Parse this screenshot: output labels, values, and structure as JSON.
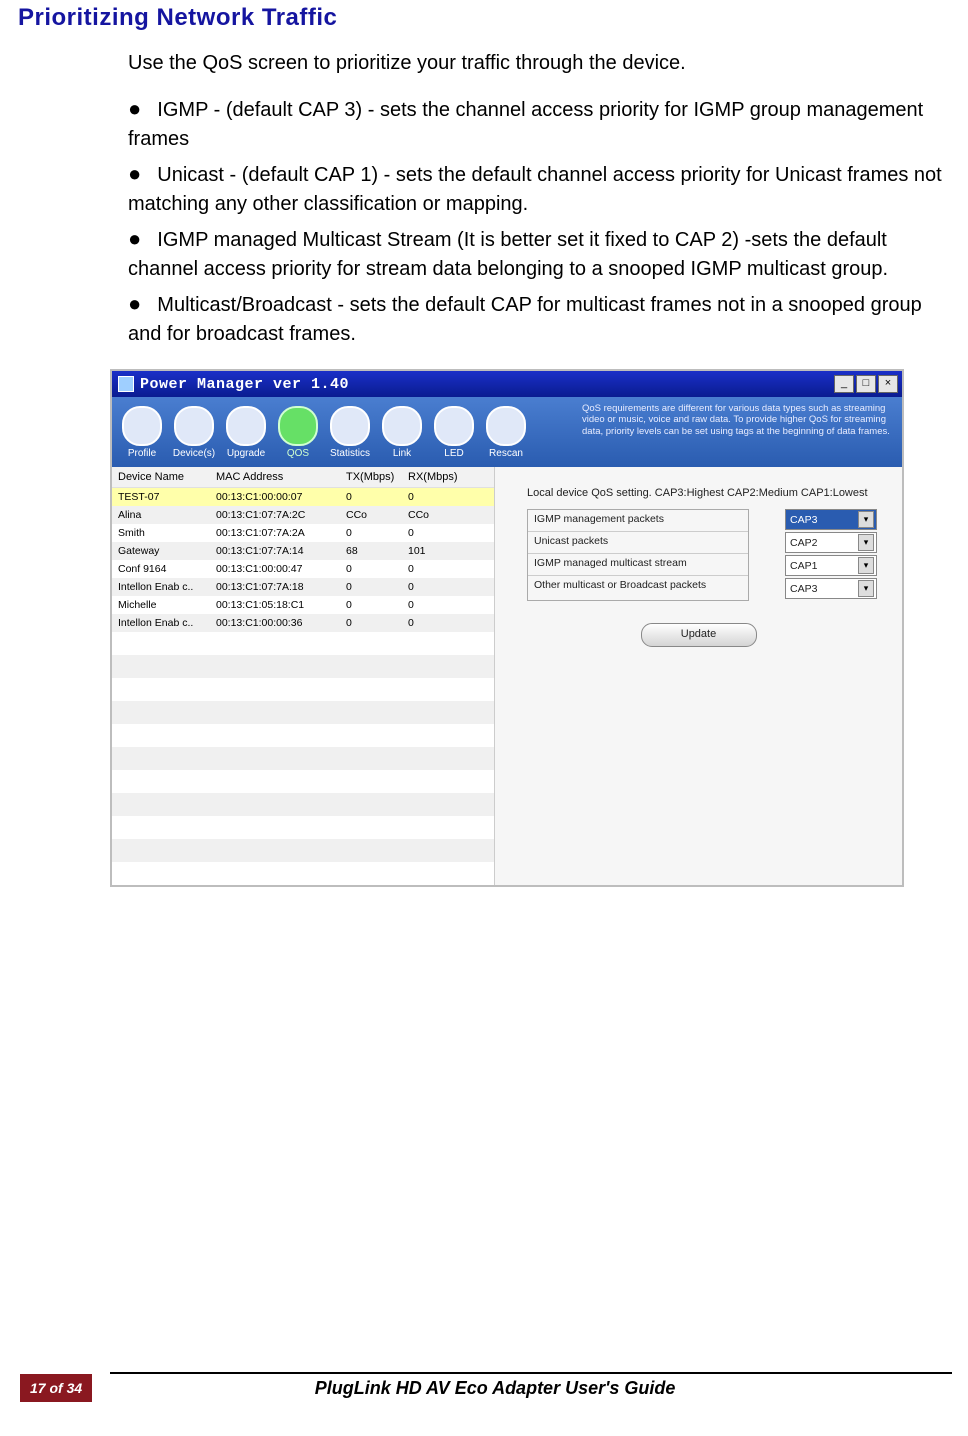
{
  "title": "Prioritizing Network Traffic",
  "intro": "Use the QoS screen to prioritize your traffic through the device.",
  "bullets": [
    "IGMP - (default CAP 3) - sets the channel access priority for IGMP group management frames",
    "Unicast - (default CAP 1) - sets the default channel access priority for Unicast frames not matching any other classification or mapping.",
    "IGMP managed Multicast Stream (It is better set it fixed to CAP 2) -sets the default channel access priority for stream data belonging to a snooped IGMP multicast group.",
    "Multicast/Broadcast - sets the default CAP for multicast frames not in a snooped group and for broadcast frames."
  ],
  "app": {
    "window_title": "Power Manager ver 1.40",
    "toolbar": [
      "Profile",
      "Device(s)",
      "Upgrade",
      "QOS",
      "Statistics",
      "Link",
      "LED",
      "Rescan"
    ],
    "active_tab": "QOS",
    "qos_desc": "QoS requirements are different for various data types such as streaming video or music, voice and raw data. To provide higher QoS for streaming data, priority levels can be set using tags at the beginning of data frames.",
    "table_headers": {
      "c1": "Device Name",
      "c2": "MAC Address",
      "c3": "TX(Mbps)",
      "c4": "RX(Mbps)"
    },
    "devices": [
      {
        "name": "TEST-07",
        "mac": "00:13:C1:00:00:07",
        "tx": "0",
        "rx": "0",
        "sel": true
      },
      {
        "name": "Alina",
        "mac": "00:13:C1:07:7A:2C",
        "tx": "CCo",
        "rx": "CCo"
      },
      {
        "name": "Smith",
        "mac": "00:13:C1:07:7A:2A",
        "tx": "0",
        "rx": "0"
      },
      {
        "name": "Gateway",
        "mac": "00:13:C1:07:7A:14",
        "tx": "68",
        "rx": "101"
      },
      {
        "name": "Conf 9164",
        "mac": "00:13:C1:00:00:47",
        "tx": "0",
        "rx": "0"
      },
      {
        "name": "Intellon Enab c..",
        "mac": "00:13:C1:07:7A:18",
        "tx": "0",
        "rx": "0"
      },
      {
        "name": "Michelle",
        "mac": "00:13:C1:05:18:C1",
        "tx": "0",
        "rx": "0"
      },
      {
        "name": "Intellon Enab c..",
        "mac": "00:13:C1:00:00:36",
        "tx": "0",
        "rx": "0"
      }
    ],
    "local_label": "Local device QoS setting. CAP3:Highest CAP2:Medium CAP1:Lowest",
    "qos_rows": [
      {
        "label": "IGMP management packets",
        "value": "CAP3",
        "hl": true
      },
      {
        "label": "Unicast packets",
        "value": "CAP2"
      },
      {
        "label": "IGMP managed multicast stream",
        "value": "CAP1"
      },
      {
        "label": "Other multicast or Broadcast packets",
        "value": "CAP3"
      }
    ],
    "update": "Update"
  },
  "footer": {
    "page": "17 of 34",
    "guide": "PlugLink HD AV Eco Adapter User's Guide"
  }
}
